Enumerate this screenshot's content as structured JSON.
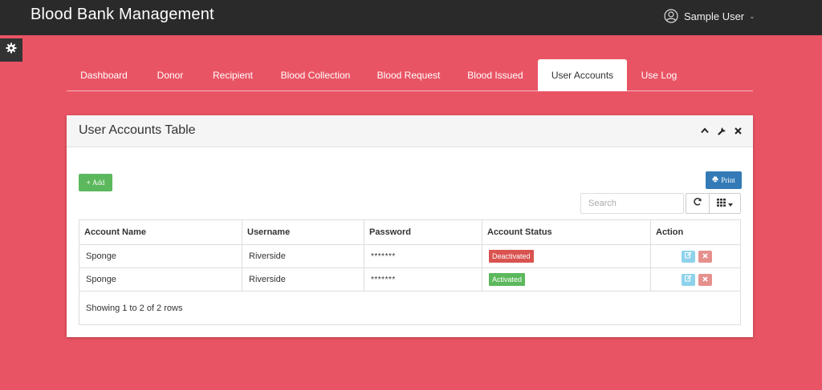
{
  "app": {
    "title": "Blood Bank Management"
  },
  "user": {
    "name": "Sample User",
    "icon": "user-circle-icon"
  },
  "tabs": [
    {
      "label": "Dashboard"
    },
    {
      "label": "Donor"
    },
    {
      "label": "Recipient"
    },
    {
      "label": "Blood Collection"
    },
    {
      "label": "Blood Request"
    },
    {
      "label": "Blood Issued"
    },
    {
      "label": "User Accounts",
      "active": true
    },
    {
      "label": "Use Log"
    }
  ],
  "panel": {
    "title": "User Accounts Table",
    "add_label": "Add",
    "print_label": "Print",
    "search_placeholder": "Search"
  },
  "table": {
    "columns": [
      "Account Name",
      "Username",
      "Password",
      "Account Status",
      "Action"
    ],
    "rows": [
      {
        "account_name": "Sponge",
        "username": "Riverside",
        "password": "*******",
        "status": "Deactivated"
      },
      {
        "account_name": "Sponge",
        "username": "Riverside",
        "password": "*******",
        "status": "Activated"
      }
    ],
    "footer": "Showing 1 to 2 of 2 rows"
  },
  "colors": {
    "background": "#e95464",
    "topbar": "#2a2a2a",
    "add": "#5cb85c",
    "print": "#337ab7",
    "deactivated": "#d9534f",
    "activated": "#5cb85c",
    "edit": "#8ed2ec",
    "delete": "#e6908e"
  }
}
